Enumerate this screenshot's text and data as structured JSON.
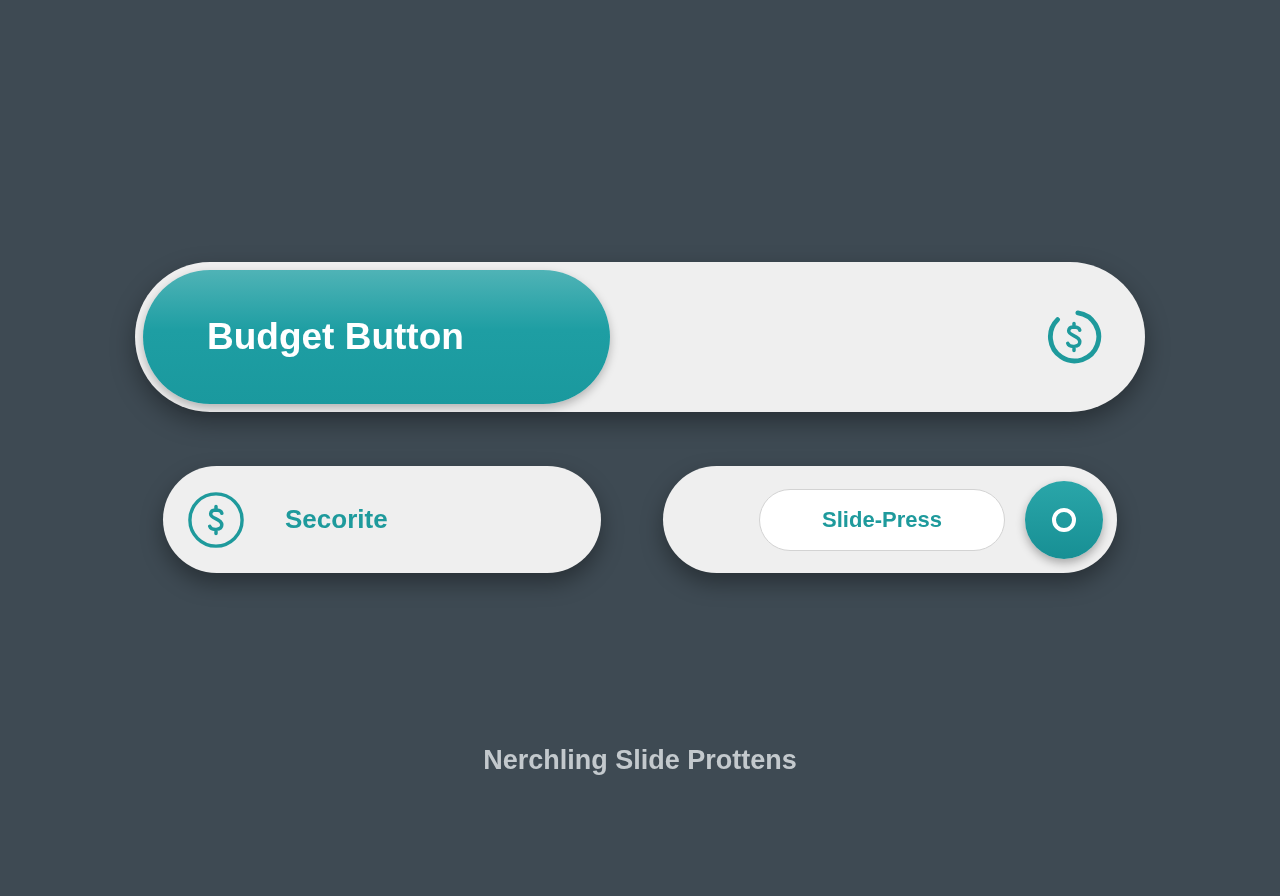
{
  "slider": {
    "label": "Budget Button"
  },
  "pills": [
    {
      "kind": "icon-label",
      "label": "Secorite"
    },
    {
      "kind": "slide-press",
      "label": "Slide-Press"
    }
  ],
  "caption": "Nerchling Slide Prottens"
}
